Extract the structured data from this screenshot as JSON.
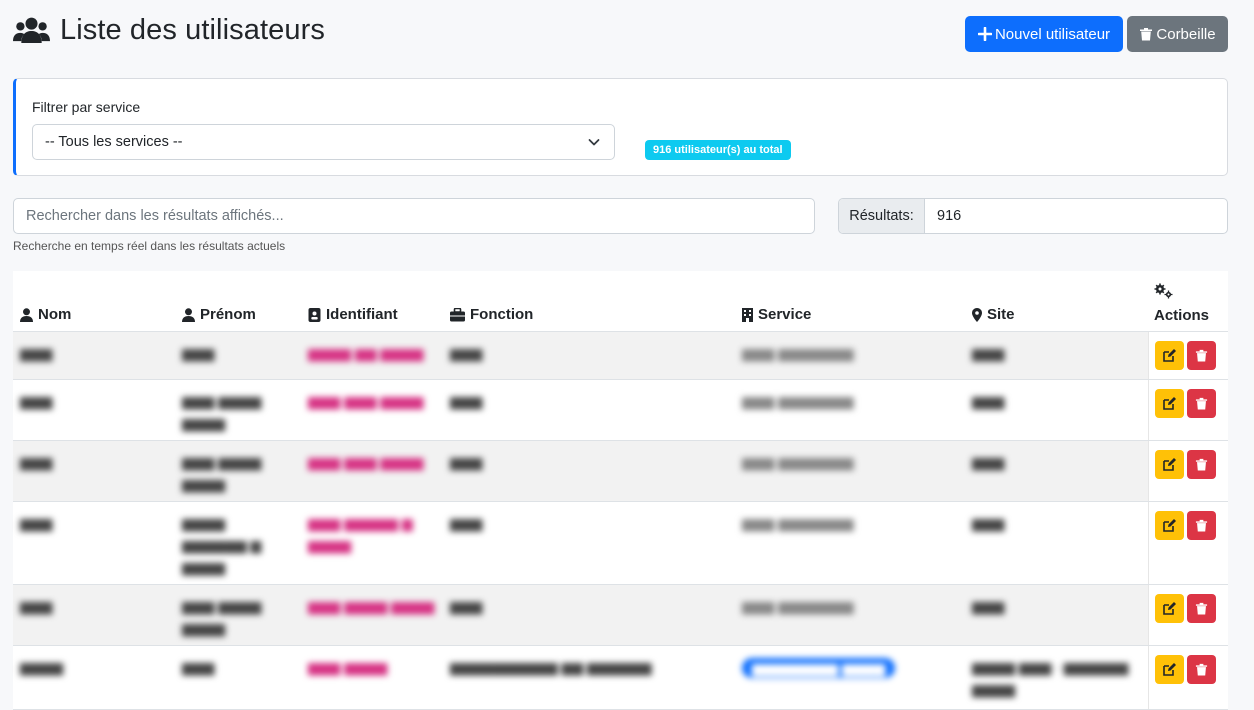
{
  "header": {
    "title": "Liste des utilisateurs",
    "icon": "users-icon",
    "new_user_label": "Nouvel utilisateur",
    "trash_label": "Corbeille"
  },
  "filter": {
    "label": "Filtrer par service",
    "selected": "-- Tous les services --",
    "total_badge": "916 utilisateur(s) au total"
  },
  "search": {
    "placeholder": "Rechercher dans les résultats affichés...",
    "help": "Recherche en temps réel dans les résultats actuels",
    "results_label": "Résultats:",
    "results_value": "916"
  },
  "table": {
    "columns": {
      "nom": "Nom",
      "prenom": "Prénom",
      "identifiant": "Identifiant",
      "fonction": "Fonction",
      "service": "Service",
      "site": "Site",
      "actions": "Actions"
    }
  },
  "colors": {
    "primary": "#0d6efd",
    "secondary": "#6c757d",
    "info": "#0dcaf0",
    "warning": "#ffc107",
    "danger": "#dc3545"
  }
}
